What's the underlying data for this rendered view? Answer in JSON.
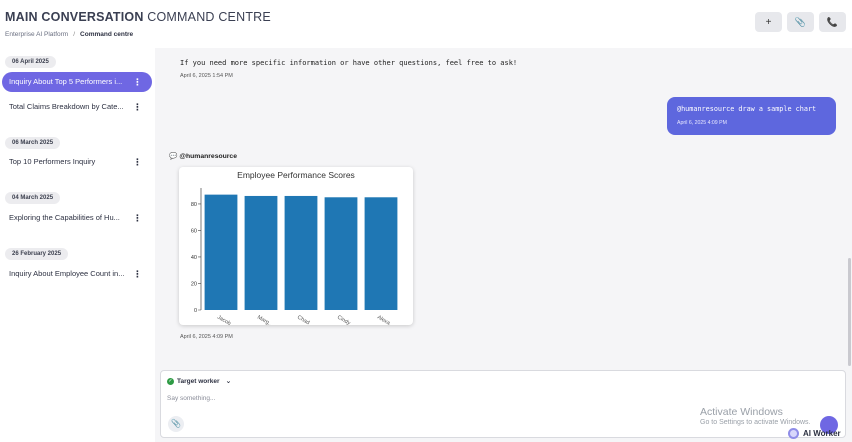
{
  "header": {
    "title_bold": "MAIN CONVERSATION",
    "title_rest": "COMMAND CENTRE",
    "breadcrumb": {
      "root": "Enterprise AI Platform",
      "separator": "/",
      "current": "Command centre"
    },
    "buttons": [
      {
        "icon": "plus-icon",
        "glyph": "+"
      },
      {
        "icon": "paperclip-icon",
        "glyph": "📎"
      },
      {
        "icon": "phone-icon",
        "glyph": "📞"
      }
    ]
  },
  "sidebar": {
    "groups": [
      {
        "date": "06 April 2025",
        "items": [
          {
            "label": "Inquiry About Top 5 Performers i...",
            "active": true
          },
          {
            "label": "Total Claims Breakdown by Cate...",
            "active": false
          }
        ]
      },
      {
        "date": "06 March 2025",
        "items": [
          {
            "label": "Top 10 Performers Inquiry",
            "active": false
          }
        ]
      },
      {
        "date": "04 March 2025",
        "items": [
          {
            "label": "Exploring the Capabilities of Hu...",
            "active": false
          }
        ]
      },
      {
        "date": "26 February 2025",
        "items": [
          {
            "label": "Inquiry About Employee Count in...",
            "active": false
          }
        ]
      }
    ],
    "kebab": "⋮"
  },
  "chat": {
    "bot_message": "If you need more specific information or have other questions, feel free to ask!",
    "bot_message_time": "April 6, 2025 1:54 PM",
    "user_message": "@humanresource draw a sample chart",
    "user_message_time": "April 6, 2025 4:09 PM",
    "sender": "@humanresource",
    "chart_time": "April 6, 2025 4:09 PM"
  },
  "chart_data": {
    "type": "bar",
    "title": "Employee Performance Scores",
    "categories": [
      "Jacob ...",
      "Marg...",
      "Chad ...",
      "Cindy ...",
      "Alexa..."
    ],
    "values": [
      87,
      86,
      86,
      85,
      85
    ],
    "ylim": [
      0,
      92
    ],
    "yticks": [
      0,
      20,
      40,
      60,
      80
    ],
    "bar_color": "#1f77b4",
    "grid": false,
    "legend": "none"
  },
  "composer": {
    "target_label": "Target worker",
    "placeholder": "Say something..."
  },
  "overlay": {
    "watermark_line1": "Activate Windows",
    "watermark_line2": "Go to Settings to activate Windows.",
    "ai_worker_label": "AI Worker"
  },
  "colors": {
    "accent": "#6f67e3",
    "user_bubble": "#5e67de",
    "chat_bg": "#f5f5f7",
    "online": "#2e9b45"
  }
}
